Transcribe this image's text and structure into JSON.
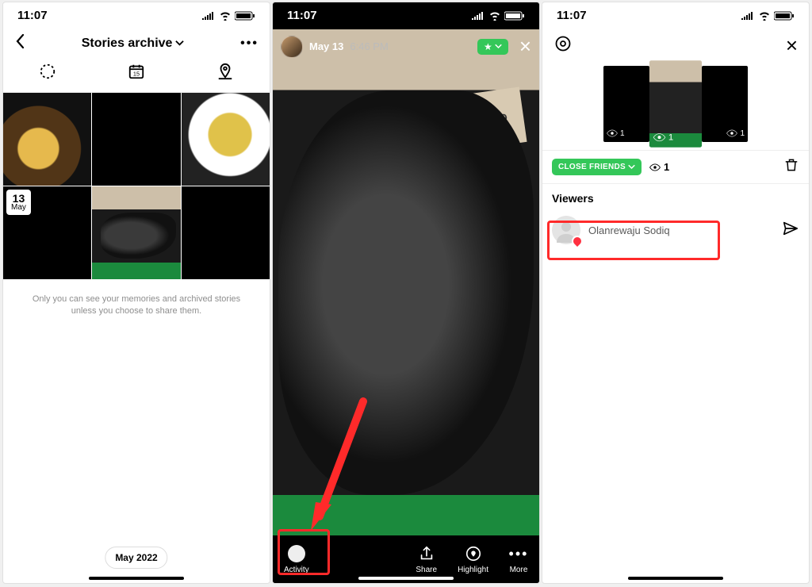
{
  "status": {
    "time": "11:07"
  },
  "screen1": {
    "title": "Stories archive",
    "grid": {
      "date_day": "13",
      "date_month": "May"
    },
    "note": "Only you can see your memories and archived stories unless you choose to share them.",
    "month_pill": "May 2022"
  },
  "screen2": {
    "date": "May 13",
    "time": "6:46 PM",
    "actions": {
      "activity": "Activity",
      "share": "Share",
      "highlight": "Highlight",
      "more": "More"
    }
  },
  "screen3": {
    "thumb_views_left": "1",
    "thumb_views_center": "1",
    "thumb_views_right": "1",
    "cf_label": "CLOSE FRIENDS",
    "view_count": "1",
    "viewers_label": "Viewers",
    "viewer_name": "Olanrewaju Sodiq"
  }
}
